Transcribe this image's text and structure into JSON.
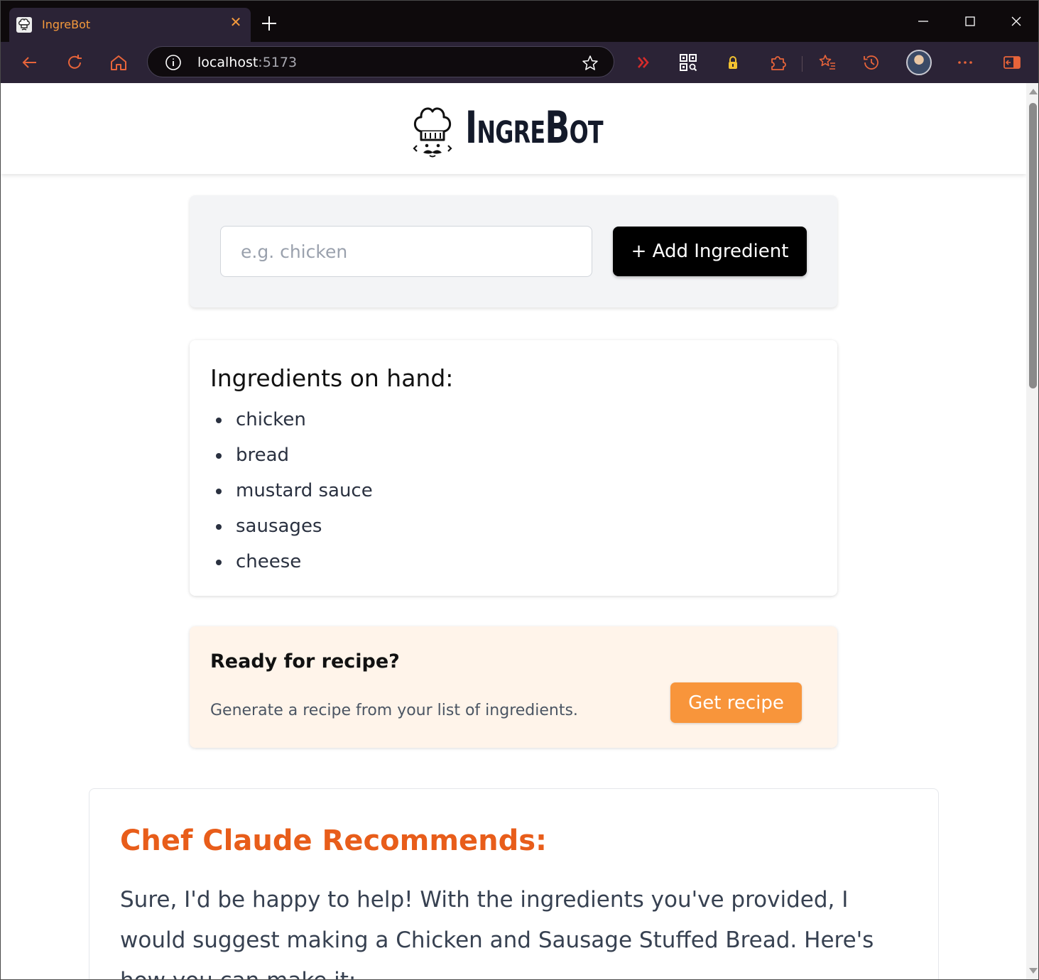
{
  "browser": {
    "tab_title": "IngreBot",
    "tab_close": "✕",
    "url_host": "localhost",
    "url_port": ":5173",
    "colors": {
      "chrome_dark": "#0e0a0c",
      "toolbar": "#2b2336",
      "accent": "#f59a3c",
      "toolbar_icon": "#e8643a"
    }
  },
  "header": {
    "logo_text": "IngreBot"
  },
  "add_form": {
    "placeholder": "e.g. chicken",
    "value": "",
    "button_label": "+ Add Ingredient"
  },
  "ingredients": {
    "title": "Ingredients on hand:",
    "items": [
      "chicken",
      "bread",
      "mustard sauce",
      "sausages",
      "cheese"
    ]
  },
  "recipe_prompt": {
    "title": "Ready for recipe?",
    "subtitle": "Generate a recipe from your list of ingredients.",
    "button_label": "Get recipe",
    "colors": {
      "background": "#fff4ea",
      "button": "#f8953b"
    }
  },
  "recommendation": {
    "title": "Chef Claude Recommends:",
    "body": "Sure, I'd be happy to help! With the ingredients you've provided, I would suggest making a Chicken and Sausage Stuffed Bread. Here's how you can make it:",
    "colors": {
      "title": "#e85d1a"
    }
  }
}
